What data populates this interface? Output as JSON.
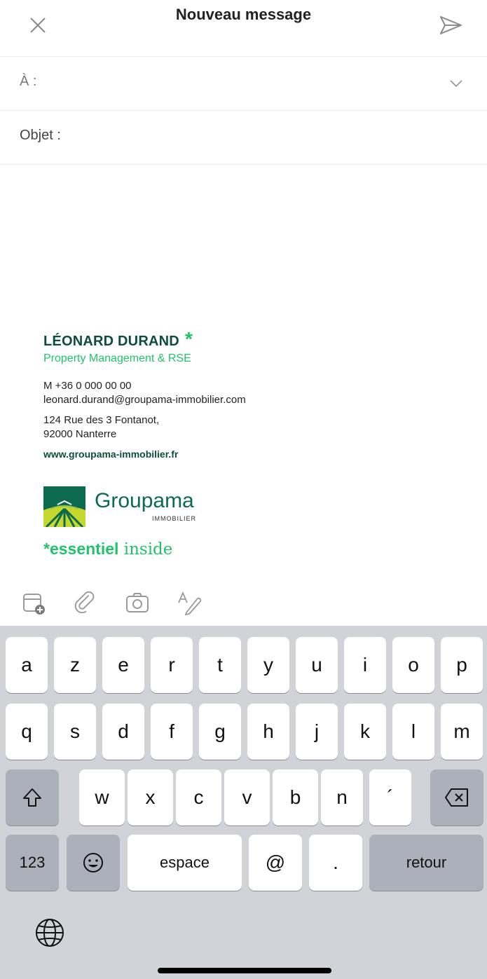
{
  "header": {
    "title": "Nouveau message"
  },
  "to_field": {
    "label": "À :"
  },
  "subject_field": {
    "label": "Objet :"
  },
  "signature": {
    "name": "LÉONARD DURAND",
    "star": "*",
    "role": "Property Management & RSE",
    "phone": "M +36 0 000 00 00",
    "email": "leonard.durand@groupama-immobilier.com",
    "address_line1": "124 Rue des 3 Fontanot,",
    "address_line2": "92000 Nanterre",
    "website": "www.groupama-immobilier.fr",
    "logo_name": "Groupama",
    "logo_sub": "IMMOBILIER",
    "tagline_star": "*",
    "tagline_bold": "essentiel",
    "tagline_rest": " inside"
  },
  "keyboard": {
    "row1": [
      "a",
      "z",
      "e",
      "r",
      "t",
      "y",
      "u",
      "i",
      "o",
      "p"
    ],
    "row2": [
      "q",
      "s",
      "d",
      "f",
      "g",
      "h",
      "j",
      "k",
      "l",
      "m"
    ],
    "row3": [
      "w",
      "x",
      "c",
      "v",
      "b",
      "n",
      "´"
    ],
    "numbers": "123",
    "space": "espace",
    "at": "@",
    "dot": ".",
    "return": "retour"
  },
  "colors": {
    "brand_green": "#0c6b4e",
    "accent_green": "#21c36a",
    "keyboard_bg": "#d1d3d9"
  }
}
